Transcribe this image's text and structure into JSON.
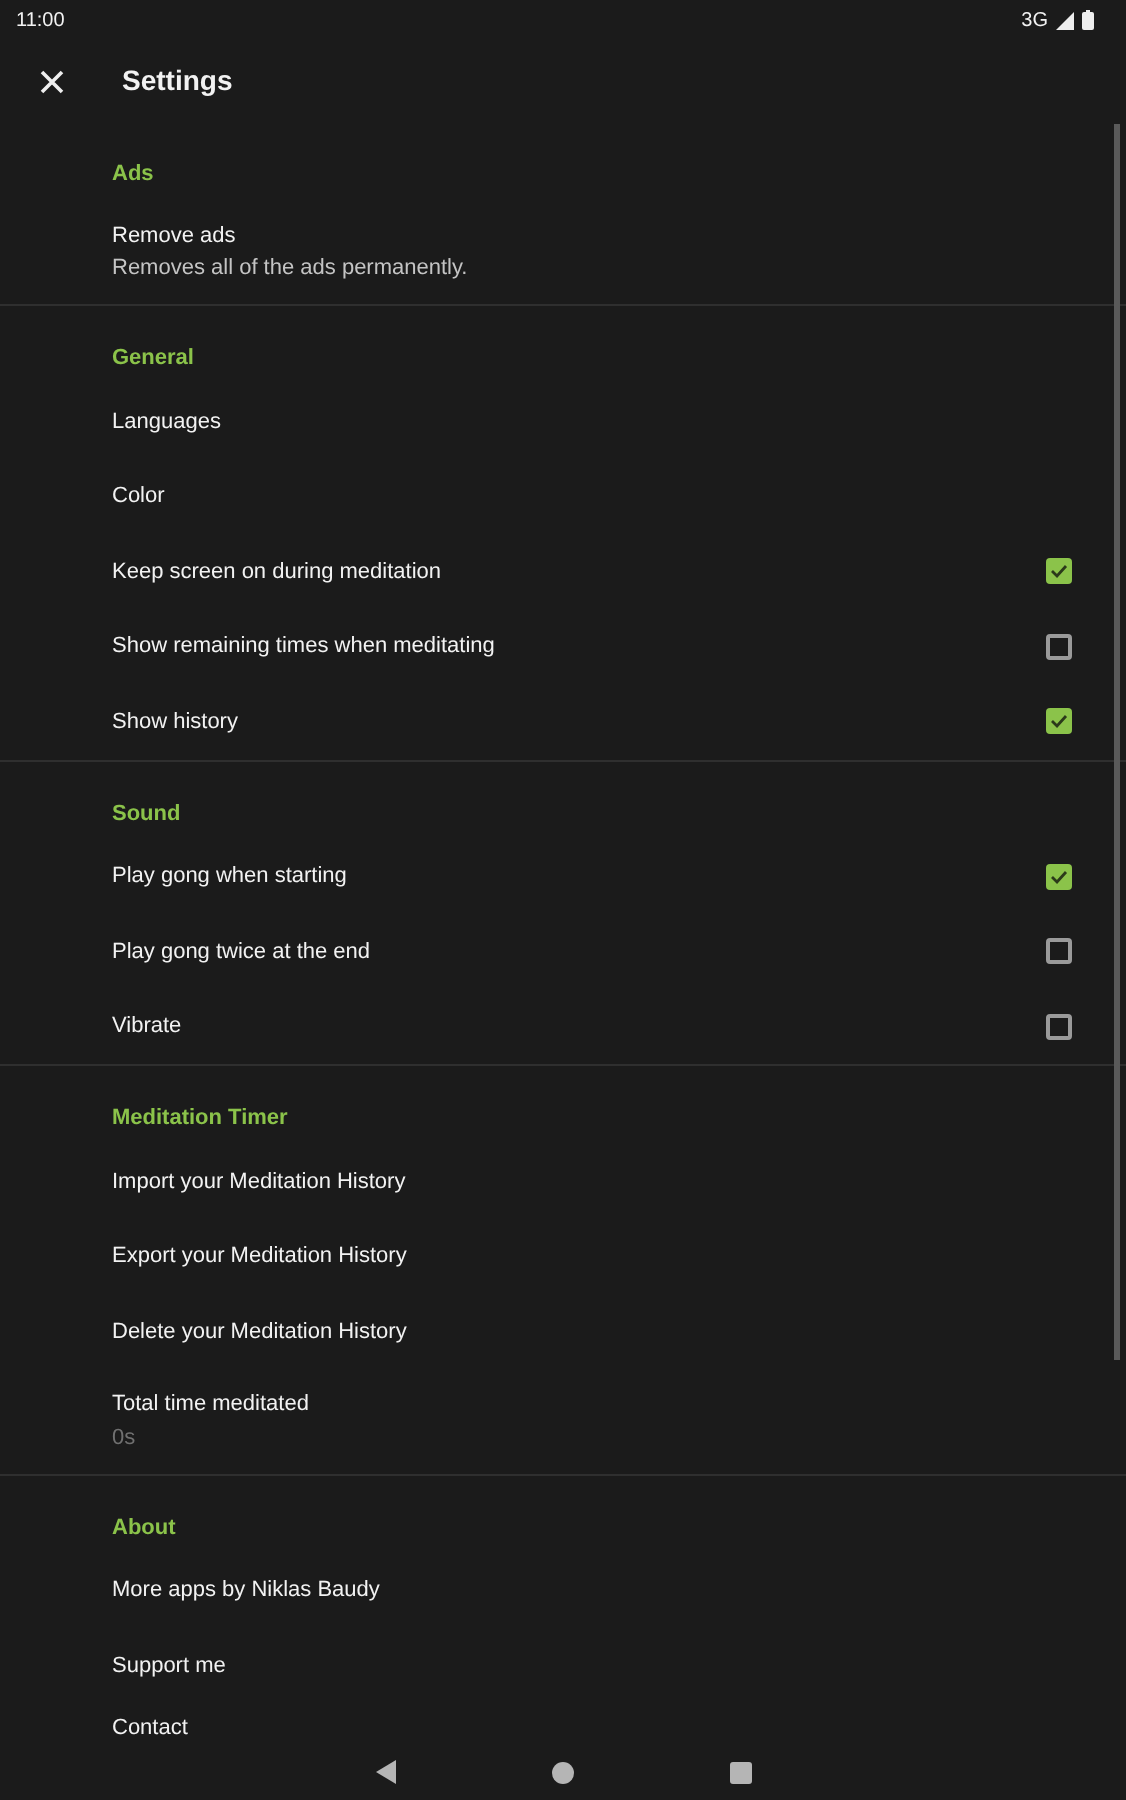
{
  "status_bar": {
    "time": "11:00",
    "network": "3G"
  },
  "toolbar": {
    "title": "Settings"
  },
  "sections": [
    {
      "header": "Ads",
      "items": [
        {
          "kind": "detail",
          "title": "Remove ads",
          "summary": "Removes all of the ads permanently."
        }
      ]
    },
    {
      "header": "General",
      "items": [
        {
          "kind": "plain",
          "title": "Languages"
        },
        {
          "kind": "plain",
          "title": "Color"
        },
        {
          "kind": "checkbox",
          "title": "Keep screen on during meditation",
          "checked": true
        },
        {
          "kind": "checkbox",
          "title": "Show remaining times when meditating",
          "checked": false
        },
        {
          "kind": "checkbox",
          "title": "Show history",
          "checked": true
        }
      ]
    },
    {
      "header": "Sound",
      "items": [
        {
          "kind": "checkbox",
          "title": "Play gong when starting",
          "checked": true
        },
        {
          "kind": "checkbox",
          "title": "Play gong twice at the end",
          "checked": false
        },
        {
          "kind": "checkbox",
          "title": "Vibrate",
          "checked": false
        }
      ]
    },
    {
      "header": "Meditation Timer",
      "items": [
        {
          "kind": "plain",
          "title": "Import your Meditation History"
        },
        {
          "kind": "plain",
          "title": "Export your Meditation History"
        },
        {
          "kind": "plain",
          "title": "Delete your Meditation History"
        },
        {
          "kind": "value",
          "title": "Total time meditated",
          "summary": "0s"
        }
      ]
    },
    {
      "header": "About",
      "items": [
        {
          "kind": "plain",
          "title": "More apps by Niklas Baudy"
        },
        {
          "kind": "plain",
          "title": "Support me"
        },
        {
          "kind": "plain",
          "title": "Contact"
        }
      ]
    }
  ]
}
